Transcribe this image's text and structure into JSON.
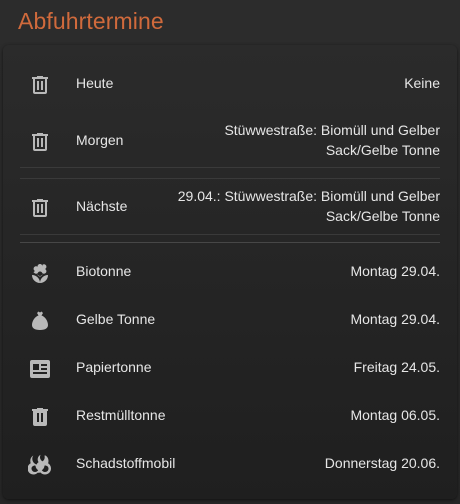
{
  "header": {
    "title": "Abfuhrtermine"
  },
  "summary": [
    {
      "icon": "trash-can-icon",
      "label": "Heute",
      "value": "Keine"
    },
    {
      "icon": "trash-can-icon",
      "label": "Morgen",
      "value": "Stüwwestraße: Biomüll und Gelber Sack/Gelbe Tonne"
    },
    {
      "icon": "trash-can-icon",
      "label": "Nächste",
      "value": "29.04.: Stüwwestraße: Biomüll und Gelber Sack/Gelbe Tonne"
    }
  ],
  "bins": [
    {
      "icon": "flower-icon",
      "label": "Biotonne",
      "value": "Montag 29.04."
    },
    {
      "icon": "sack-icon",
      "label": "Gelbe Tonne",
      "value": "Montag 29.04."
    },
    {
      "icon": "newspaper-icon",
      "label": "Papiertonne",
      "value": "Freitag 24.05."
    },
    {
      "icon": "trash-can-icon",
      "label": "Restmülltonne",
      "value": "Montag 06.05."
    },
    {
      "icon": "biohazard-icon",
      "label": "Schadstoffmobil",
      "value": "Donnerstag 20.06."
    }
  ]
}
